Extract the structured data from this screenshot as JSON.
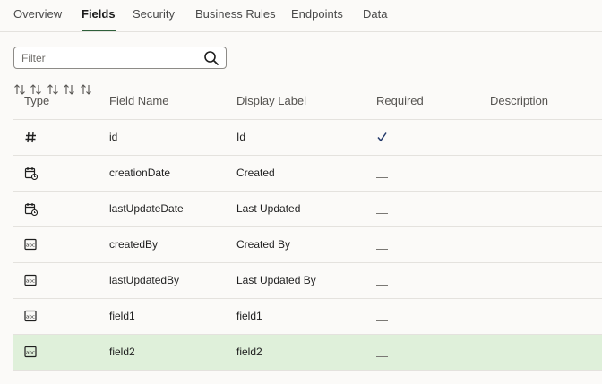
{
  "tabs": [
    {
      "label": "Overview",
      "active": false
    },
    {
      "label": "Fields",
      "active": true
    },
    {
      "label": "Security",
      "active": false
    },
    {
      "label": "Business Rules",
      "active": false
    },
    {
      "label": "Endpoints",
      "active": false
    },
    {
      "label": "Data",
      "active": false
    }
  ],
  "filter": {
    "placeholder": "Filter",
    "value": ""
  },
  "columns": {
    "type": "Type",
    "field_name": "Field Name",
    "display_label": "Display Label",
    "required": "Required",
    "description": "Description"
  },
  "rows": [
    {
      "type_icon": "number-icon",
      "field_name": "id",
      "display_label": "Id",
      "required": true,
      "description": ""
    },
    {
      "type_icon": "datetime-icon",
      "field_name": "creationDate",
      "display_label": "Created",
      "required": false,
      "description": ""
    },
    {
      "type_icon": "datetime-icon",
      "field_name": "lastUpdateDate",
      "display_label": "Last Updated",
      "required": false,
      "description": ""
    },
    {
      "type_icon": "string-icon",
      "field_name": "createdBy",
      "display_label": "Created By",
      "required": false,
      "description": ""
    },
    {
      "type_icon": "string-icon",
      "field_name": "lastUpdatedBy",
      "display_label": "Last Updated By",
      "required": false,
      "description": ""
    },
    {
      "type_icon": "string-icon",
      "field_name": "field1",
      "display_label": "field1",
      "required": false,
      "description": ""
    },
    {
      "type_icon": "string-icon",
      "field_name": "field2",
      "display_label": "field2",
      "required": false,
      "description": "",
      "selected": true
    }
  ],
  "colors": {
    "accent": "#2e5f3a",
    "selected_row": "#dff0da"
  }
}
